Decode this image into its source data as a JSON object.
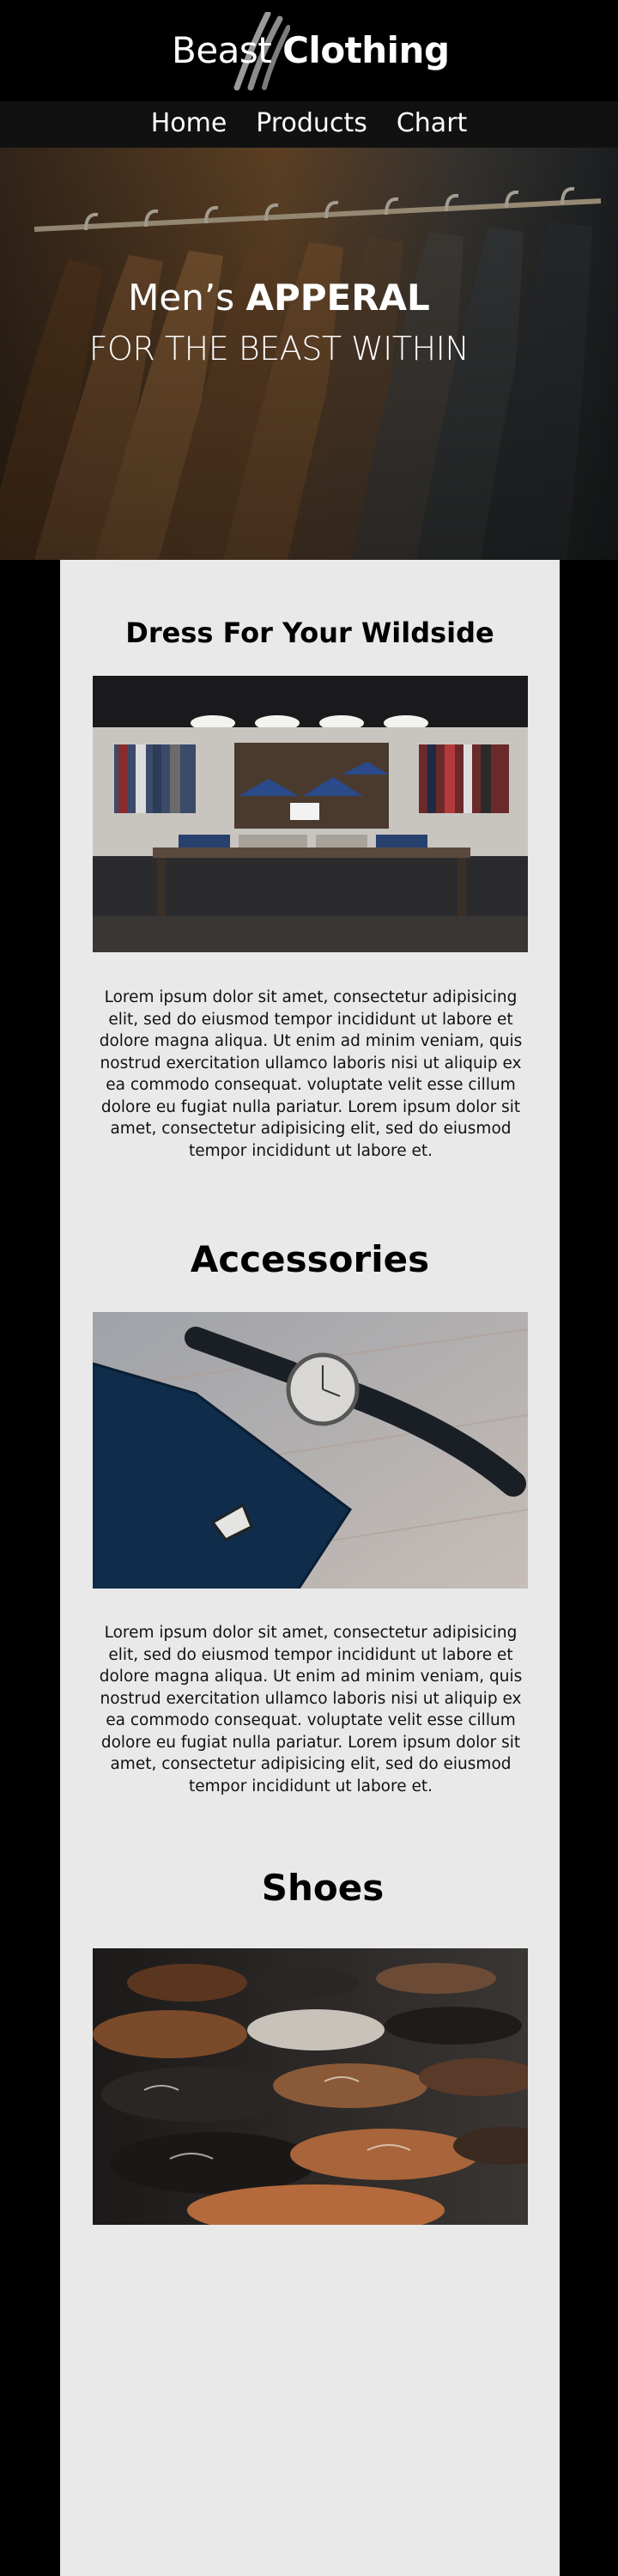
{
  "brand": {
    "name_light": "Beast ",
    "name_bold": "Clothing"
  },
  "nav": {
    "items": [
      {
        "label": "Home"
      },
      {
        "label": "Products"
      },
      {
        "label": "Chart"
      }
    ]
  },
  "hero": {
    "title_light": "Men’s ",
    "title_bold": "APPERAL",
    "subtitle": "FOR THE BEAST WITHIN"
  },
  "sections": [
    {
      "title": "Dress For Your Wildside",
      "image": "clothing-store-photo",
      "text": "Lorem ipsum dolor sit amet, consectetur adipisicing elit, sed do eiusmod tempor incididunt ut labore et dolore magna aliqua. Ut enim ad minim veniam, quis nostrud exercitation ullamco laboris nisi ut aliquip ex ea commodo consequat. voluptate velit esse cillum dolore eu fugiat nulla pariatur. Lorem ipsum dolor sit amet, consectetur adipisicing elit, sed do eiusmod tempor incididunt ut labore et."
    },
    {
      "title": "Accessories",
      "image": "tie-and-watch-photo",
      "text": "Lorem ipsum dolor sit amet, consectetur adipisicing elit, sed do eiusmod tempor incididunt ut labore et dolore magna aliqua. Ut enim ad minim veniam, quis nostrud exercitation ullamco laboris nisi ut aliquip ex ea commodo consequat. voluptate velit esse cillum dolore eu fugiat nulla pariatur. Lorem ipsum dolor sit amet, consectetur adipisicing elit, sed do eiusmod tempor incididunt ut labore et."
    },
    {
      "title": "Shoes",
      "image": "shoes-rack-photo"
    }
  ],
  "colors": {
    "page_bg": "#000000",
    "card_bg": "#e9e9e9",
    "text": "#000000",
    "nav_text": "#ffffff"
  }
}
